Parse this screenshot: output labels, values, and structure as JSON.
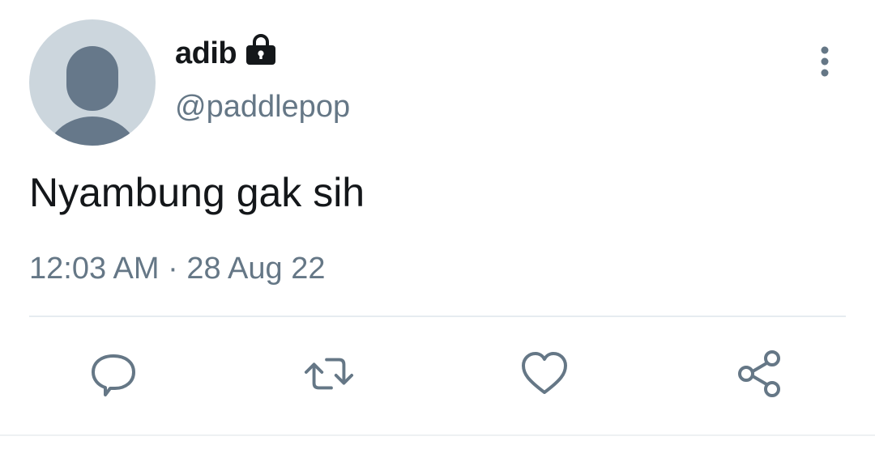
{
  "user": {
    "display_name": "adib",
    "handle": "@paddlepop",
    "protected_icon": "lock-icon",
    "avatar_icon": "default-avatar-silhouette"
  },
  "tweet": {
    "text": "Nyambung gak sih",
    "timestamp": "12:03 AM · 28 Aug 22"
  },
  "actions": {
    "reply_icon": "speech-bubble-icon",
    "retweet_icon": "retweet-icon",
    "like_icon": "heart-icon",
    "share_icon": "share-icon"
  },
  "menu": {
    "more_icon": "vertical-dots-icon"
  },
  "colors": {
    "text_primary": "#14171a",
    "text_secondary": "#657786",
    "avatar_bg": "#ccd6dd",
    "avatar_fg": "#66788a",
    "divider": "#e6ecf0"
  }
}
